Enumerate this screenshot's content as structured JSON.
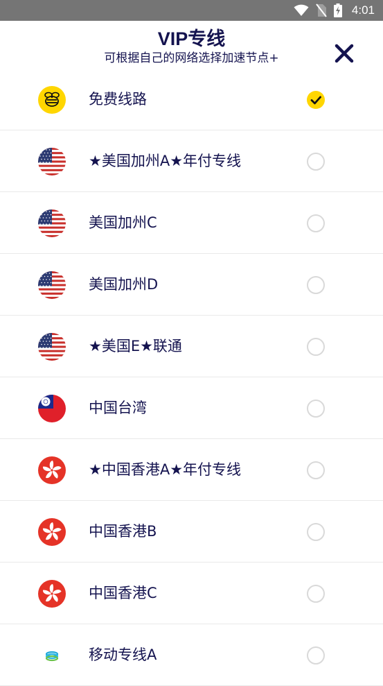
{
  "status_bar": {
    "time": "4:01",
    "icons": [
      "wifi-icon",
      "no-sim-icon",
      "battery-charging-icon"
    ]
  },
  "header": {
    "title": "VIP专线",
    "subtitle": "可根据自己的网络选择加速节点+",
    "close_icon": "close-icon"
  },
  "colors": {
    "text": "#14134f",
    "accent": "#ffd600",
    "divider": "#e9e9e9",
    "status_bar": "#757575"
  },
  "lines": [
    {
      "label": "免费线路",
      "icon": "bee-icon",
      "selected": true
    },
    {
      "label": "★美国加州A★年付专线",
      "icon": "us-flag-icon",
      "selected": false
    },
    {
      "label": "美国加州C",
      "icon": "us-flag-icon",
      "selected": false
    },
    {
      "label": "美国加州D",
      "icon": "us-flag-icon",
      "selected": false
    },
    {
      "label": "★美国E★联通",
      "icon": "us-flag-icon",
      "selected": false
    },
    {
      "label": "中国台湾",
      "icon": "taiwan-flag-icon",
      "selected": false
    },
    {
      "label": "★中国香港A★年付专线",
      "icon": "hong-kong-flag-icon",
      "selected": false
    },
    {
      "label": "中国香港B",
      "icon": "hong-kong-flag-icon",
      "selected": false
    },
    {
      "label": "中国香港C",
      "icon": "hong-kong-flag-icon",
      "selected": false
    },
    {
      "label": "移动专线A",
      "icon": "china-mobile-icon",
      "selected": false
    }
  ]
}
